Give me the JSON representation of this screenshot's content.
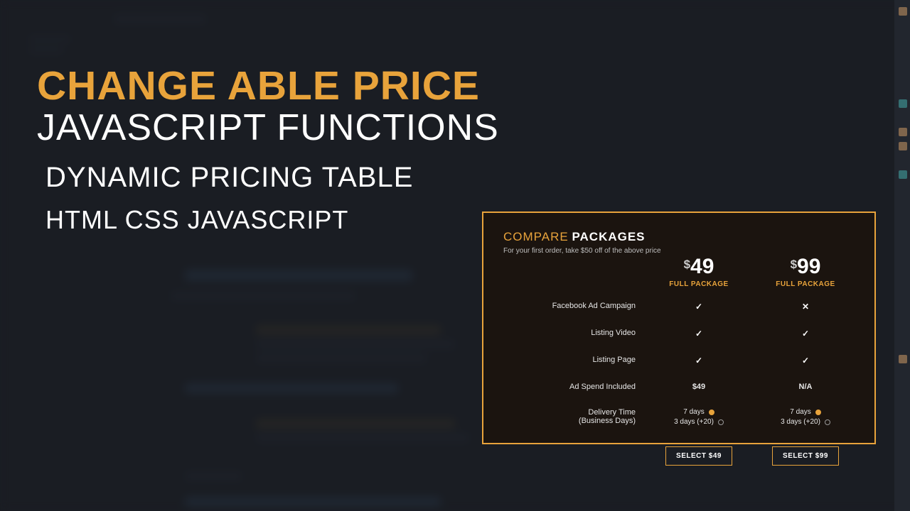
{
  "headlines": {
    "line1": "CHANGE ABLE PRICE",
    "line2": "JAVASCRIPT FUNCTIONS",
    "line3": "DYNAMIC PRICING TABLE",
    "line4": "HTML CSS JAVASCRIPT"
  },
  "panel": {
    "title_accent": "COMPARE",
    "title_bold": "PACKAGES",
    "subtitle": "For your first order, take $50 off of the above price",
    "plan_label": "FULL PACKAGE",
    "features": [
      "Facebook Ad Campaign",
      "Listing Video",
      "Listing Page",
      "Ad Spend Included",
      "Delivery Time",
      "(Business Days)"
    ],
    "plans": [
      {
        "currency": "$",
        "price": "49",
        "f_campaign": "check",
        "f_video": "check",
        "f_page": "check",
        "ad_spend": "$49",
        "delivery_a": "7 days",
        "delivery_b": "3 days (+20)",
        "select_label": "SELECT",
        "select_amount": "$49"
      },
      {
        "currency": "$",
        "price": "99",
        "f_campaign": "cross",
        "f_video": "check",
        "f_page": "check",
        "ad_spend": "N/A",
        "delivery_a": "7 days",
        "delivery_b": "3 days (+20)",
        "select_label": "SELECT",
        "select_amount": "$99"
      }
    ]
  },
  "colors": {
    "accent": "#e8a33b",
    "panel_bg": "#1b140f",
    "page_bg": "#1a1d23"
  }
}
